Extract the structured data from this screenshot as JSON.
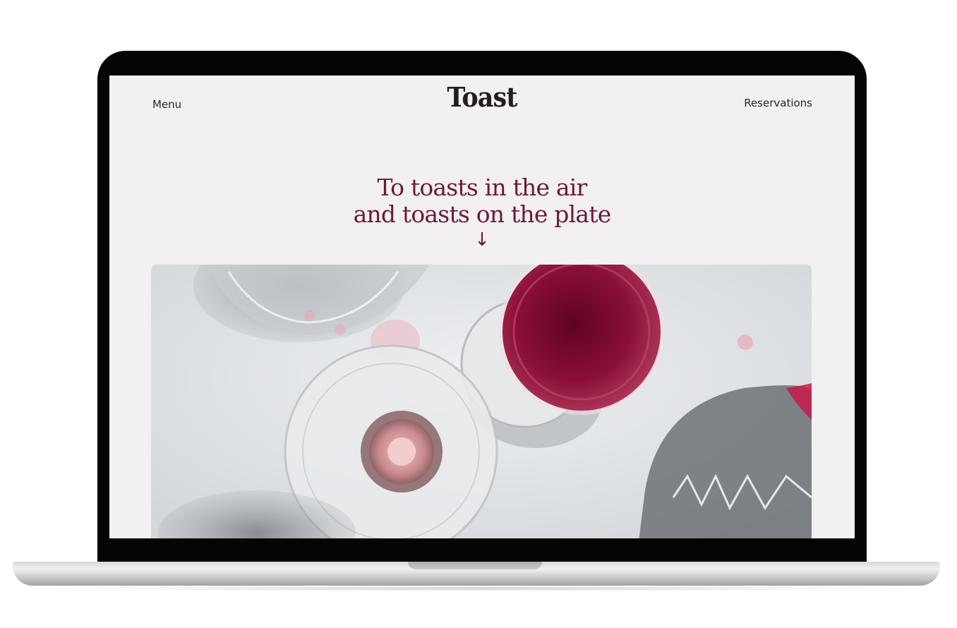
{
  "site": {
    "logo": "Toast",
    "nav": {
      "menu_label": "Menu",
      "reservations_label": "Reservations"
    },
    "hero": {
      "headline_line1": "To toasts in the air",
      "headline_line2": "and toasts on the plate",
      "scroll_arrow": "↓",
      "image_icon": "wine-glasses-photo"
    }
  },
  "colors": {
    "accent": "#6c1a36",
    "page_background": "#f3f0f1",
    "text": "#2a2425",
    "wine": "#7a0e2e"
  }
}
